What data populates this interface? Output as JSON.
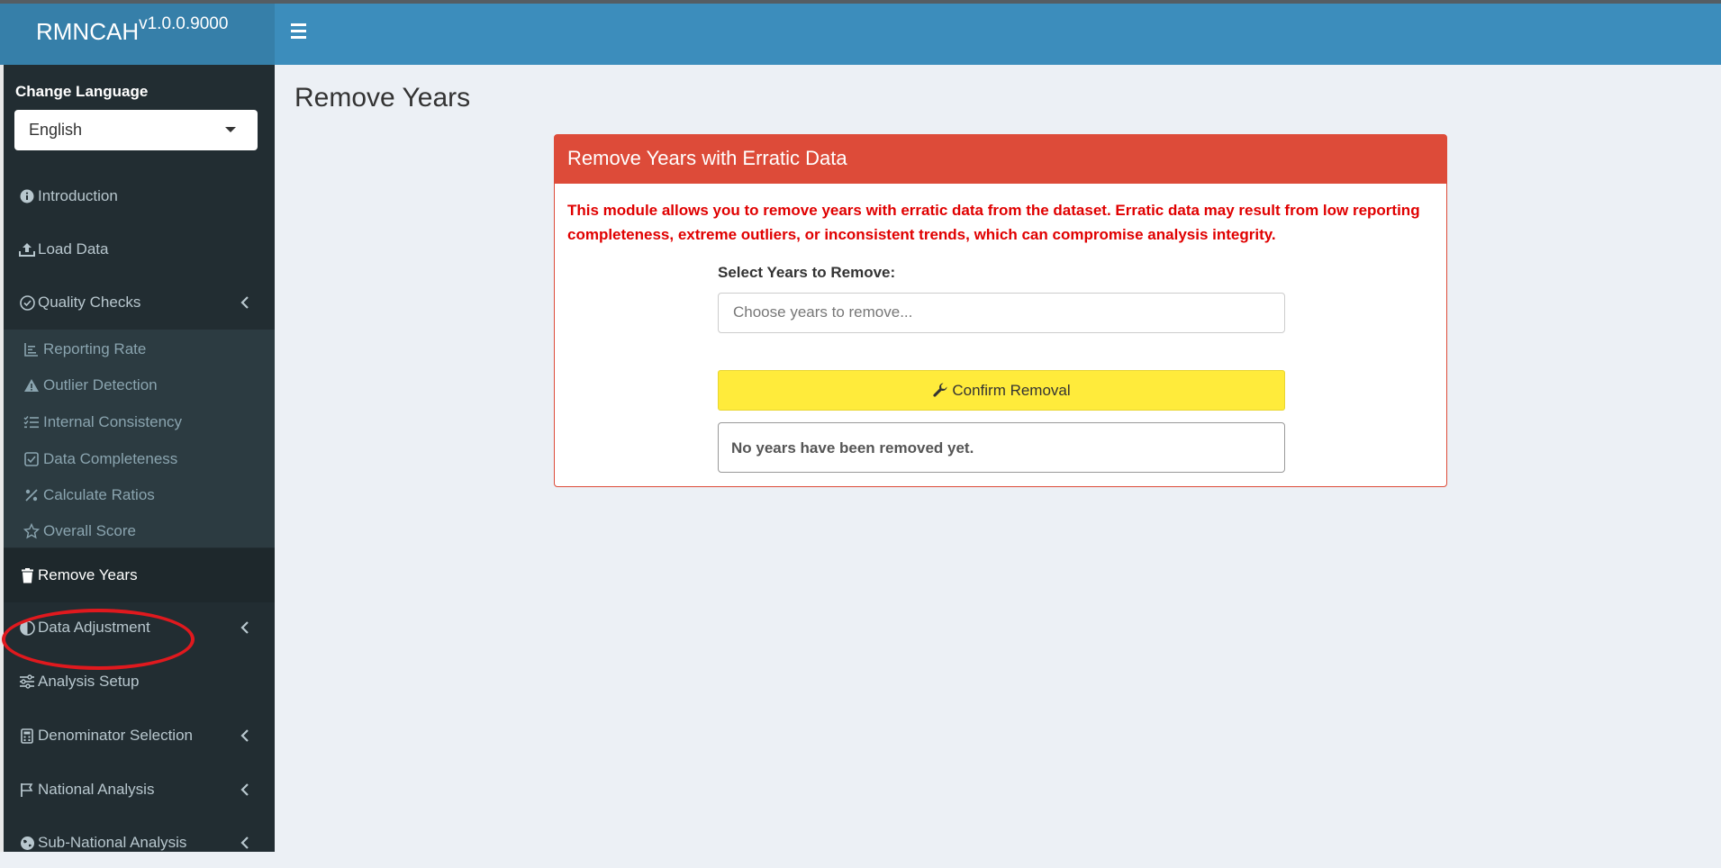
{
  "app": {
    "brand_name": "RMNCAH",
    "brand_version": "v1.0.0.9000"
  },
  "sidebar": {
    "language_label": "Change Language",
    "language_value": "English",
    "items": [
      {
        "label": "Introduction",
        "icon": "info-circle-icon"
      },
      {
        "label": "Load Data",
        "icon": "upload-icon"
      },
      {
        "label": "Quality Checks",
        "icon": "check-circle-icon"
      },
      {
        "label": "Remove Years",
        "icon": "trash-icon"
      },
      {
        "label": "Data Adjustment",
        "icon": "half-circle-icon"
      },
      {
        "label": "Analysis Setup",
        "icon": "sliders-icon"
      },
      {
        "label": "Denominator Selection",
        "icon": "calculator-icon"
      },
      {
        "label": "National Analysis",
        "icon": "flag-icon"
      },
      {
        "label": "Sub-National Analysis",
        "icon": "globe-icon"
      }
    ],
    "quality_submenu": [
      {
        "label": "Reporting Rate",
        "icon": "chart-line-icon"
      },
      {
        "label": "Outlier Detection",
        "icon": "warning-icon"
      },
      {
        "label": "Internal Consistency",
        "icon": "list-check-icon"
      },
      {
        "label": "Data Completeness",
        "icon": "check-square-icon"
      },
      {
        "label": "Calculate Ratios",
        "icon": "percent-icon"
      },
      {
        "label": "Overall Score",
        "icon": "star-icon"
      }
    ]
  },
  "main": {
    "page_title": "Remove Years",
    "box_title": "Remove Years with Erratic Data",
    "description": "This module allows you to remove years with erratic data from the dataset. Erratic data may result from low reporting completeness, extreme outliers, or inconsistent trends, which can compromise analysis integrity.",
    "select_label": "Select Years to Remove:",
    "select_placeholder": "Choose years to remove...",
    "confirm_button": "Confirm Removal",
    "status_message": "No years have been removed yet."
  },
  "colors": {
    "header_blue": "#3c8dbc",
    "brand_blue": "#367fa9",
    "sidebar_bg": "#222d32",
    "danger_red": "#dd4b39",
    "confirm_yellow": "#ffeb3b",
    "annotation_red": "#e0191e"
  }
}
